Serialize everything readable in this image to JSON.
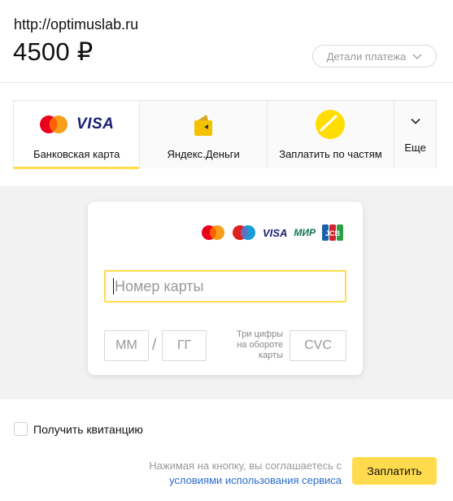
{
  "header": {
    "merchant_url": "http://optimuslab.ru",
    "amount": "4500 ₽",
    "details_label": "Детали платежа"
  },
  "tabs": [
    {
      "label": "Банковская карта",
      "icon": "mastercard-visa-icon",
      "active": true
    },
    {
      "label": "Яндекс.Деньги",
      "icon": "yandex-money-wallet-icon",
      "active": false
    },
    {
      "label": "Заплатить по частям",
      "icon": "yellow-circle-icon",
      "active": false
    },
    {
      "label": "Еще",
      "icon": "chevron-down-icon",
      "active": false
    }
  ],
  "brands": {
    "visa": "VISA",
    "mir": "МИР",
    "jcb": "JCB"
  },
  "card_form": {
    "number_placeholder": "Номер карты",
    "month_placeholder": "ММ",
    "separator": "/",
    "year_placeholder": "ГГ",
    "cvc_hint": "Три цифры на обороте карты",
    "cvc_placeholder": "CVC"
  },
  "receipt": {
    "label": "Получить квитанцию",
    "checked": false
  },
  "footer": {
    "agree_text": "Нажимая на кнопку, вы соглашаетесь с",
    "terms_link": "условиями использования сервиса",
    "pay_label": "Заплатить"
  },
  "colors": {
    "accent": "#ffdb4d",
    "link": "#2a6ccc",
    "visa": "#1a1f71",
    "mir": "#0f754e"
  }
}
